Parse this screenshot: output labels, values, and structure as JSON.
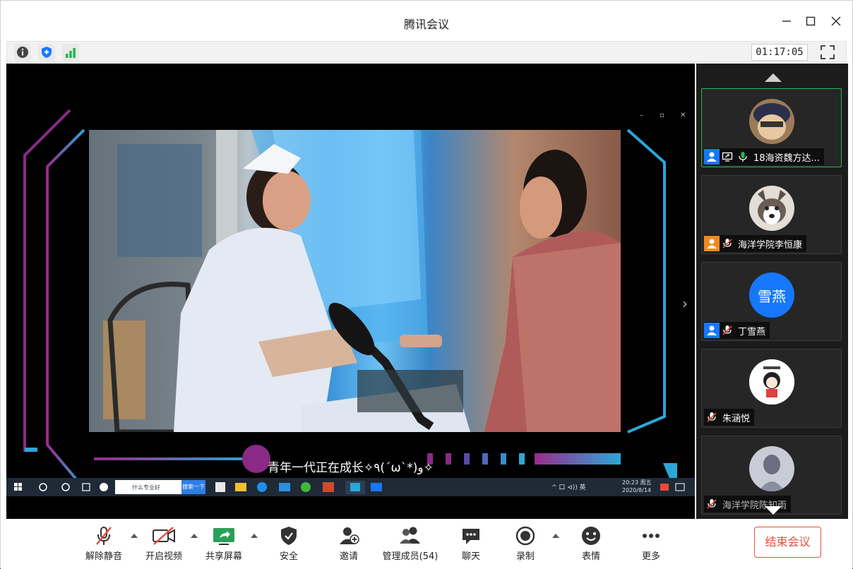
{
  "window": {
    "title": "腾讯会议"
  },
  "infobar": {
    "timer": "01:17:05"
  },
  "stage": {
    "caption": "青年一代正在成长✧٩(ˊωˋ*)و✧",
    "taskbar": {
      "search_placeholder": "什么专业好",
      "search_button": "搜索一下",
      "tray_text": "^ 口 ⊲)) 英",
      "clock_time": "20:23 周五",
      "clock_date": "2020/8/14"
    }
  },
  "participants": [
    {
      "name": "18海资魏方达...",
      "avatar_text": "",
      "avatar_color": "#8a6a4a",
      "host_badge": "#1677ff",
      "muted": false,
      "sharing": true,
      "active": true
    },
    {
      "name": "海洋学院李恒康",
      "avatar_text": "",
      "avatar_color": "#d9d2c6",
      "host_badge": "#f08a1c",
      "muted": true,
      "sharing": false,
      "active": false
    },
    {
      "name": "丁雪燕",
      "avatar_text": "雪燕",
      "avatar_color": "#1677ff",
      "host_badge": "#1677ff",
      "muted": true,
      "sharing": false,
      "active": false
    },
    {
      "name": "朱涵悦",
      "avatar_text": "",
      "avatar_color": "#ffffff",
      "host_badge": "",
      "muted": true,
      "sharing": false,
      "active": false
    },
    {
      "name": "海洋学院陈知雨",
      "avatar_text": "",
      "avatar_color": "#c9ccd6",
      "host_badge": "",
      "muted": true,
      "sharing": false,
      "active": false
    }
  ],
  "controls": {
    "unmute": "解除静音",
    "start_video": "开启视频",
    "share_screen": "共享屏幕",
    "security": "安全",
    "invite": "邀请",
    "manage_members": "管理成员(54)",
    "chat": "聊天",
    "record": "录制",
    "reactions": "表情",
    "more": "更多",
    "end_meeting": "结束会议"
  },
  "colors": {
    "accent_blue": "#1677ff",
    "end_red": "#e74c3c",
    "active_green": "#2bb55a"
  }
}
